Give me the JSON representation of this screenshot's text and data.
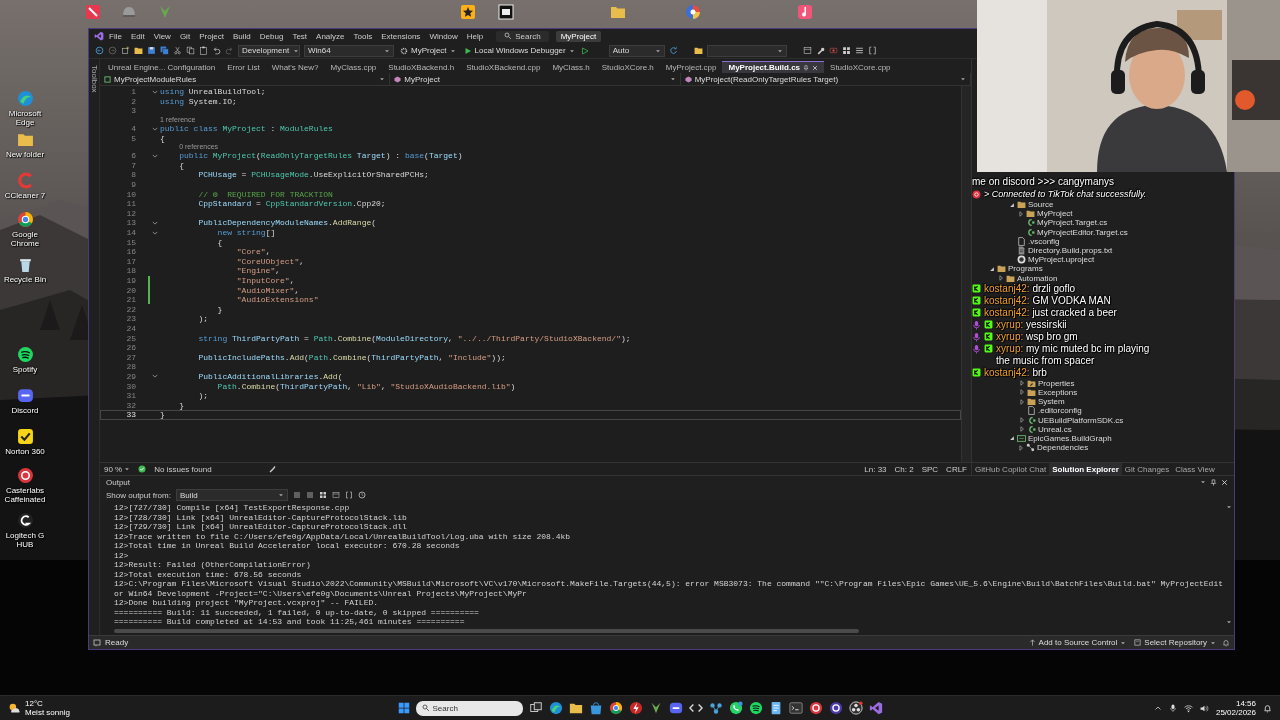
{
  "desktop": {
    "icons": [
      {
        "label": "Microsoft Edge"
      },
      {
        "label": "New folder"
      },
      {
        "label": "CCleaner 7"
      },
      {
        "label": "Google Chrome"
      },
      {
        "label": "Recycle Bin"
      },
      {
        "label": "Spotify"
      },
      {
        "label": "Discord"
      },
      {
        "label": "Norton 360"
      },
      {
        "label": "Casterlabs Caffeinated"
      },
      {
        "label": "Logitech G HUB"
      }
    ]
  },
  "ide": {
    "menu": [
      "File",
      "Edit",
      "View",
      "Git",
      "Project",
      "Build",
      "Debug",
      "Test",
      "Analyze",
      "Tools",
      "Extensions",
      "Window",
      "Help"
    ],
    "search": "Search",
    "project_name": "MyProject",
    "toolbar": {
      "configuration": "Development",
      "platform": "Win64",
      "startup_project": "MyProject",
      "debugger": "Local Windows Debugger",
      "mode": "Auto"
    },
    "toolbox_tab": "Toolbox",
    "tabs": [
      {
        "label": "Unreal Engine... Configuration",
        "selected": false
      },
      {
        "label": "Error List",
        "selected": false
      },
      {
        "label": "What's New?",
        "selected": false
      },
      {
        "label": "MyClass.cpp",
        "selected": false
      },
      {
        "label": "StudioXBackend.h",
        "selected": false
      },
      {
        "label": "StudioXBackend.cpp",
        "selected": false
      },
      {
        "label": "MyClass.h",
        "selected": false
      },
      {
        "label": "StudioXCore.h",
        "selected": false
      },
      {
        "label": "MyProject.cpp",
        "selected": false
      },
      {
        "label": "MyProject.Build.cs",
        "selected": true
      },
      {
        "label": "StudioXCore.cpp",
        "selected": false
      }
    ],
    "navigation": [
      "MyProjectModuleRules",
      "MyProject",
      "MyProject(ReadOnlyTargetRules Target)"
    ],
    "code_lines": [
      {
        "number": "1",
        "fold": true,
        "changed": false,
        "current": false,
        "tokens": [
          {
            "kind": "kw",
            "text": "using"
          },
          {
            "kind": "txt",
            "text": " UnrealBuildTool;"
          }
        ]
      },
      {
        "number": "2",
        "fold": false,
        "changed": false,
        "current": false,
        "tokens": [
          {
            "kind": "kw",
            "text": "using"
          },
          {
            "kind": "txt",
            "text": " System.IO;"
          }
        ]
      },
      {
        "number": "3",
        "fold": false,
        "changed": false,
        "current": false
      },
      {
        "number": "4",
        "fold": true,
        "changed": false,
        "current": false,
        "lens": "1 reference",
        "tokens": [
          {
            "kind": "kw",
            "text": "public class"
          },
          {
            "kind": "type",
            "text": " MyProject"
          },
          {
            "kind": "txt",
            "text": " : "
          },
          {
            "kind": "type",
            "text": "ModuleRules"
          }
        ]
      },
      {
        "number": "5",
        "fold": false,
        "changed": false,
        "current": false,
        "tokens": [
          {
            "kind": "txt",
            "text": "{"
          }
        ]
      },
      {
        "number": "6",
        "fold": true,
        "changed": false,
        "current": false,
        "lens": "0 references",
        "tokens": [
          {
            "kind": "kw",
            "text": "    public"
          },
          {
            "kind": "type",
            "text": " MyProject"
          },
          {
            "kind": "txt",
            "text": "("
          },
          {
            "kind": "type",
            "text": "ReadOnlyTargetRules"
          },
          {
            "kind": "var",
            "text": " Target"
          },
          {
            "kind": "txt",
            "text": ") : "
          },
          {
            "kind": "kw",
            "text": "base"
          },
          {
            "kind": "txt",
            "text": "("
          },
          {
            "kind": "var",
            "text": "Target"
          },
          {
            "kind": "txt",
            "text": ")"
          }
        ]
      },
      {
        "number": "7",
        "fold": false,
        "changed": false,
        "current": false,
        "tokens": [
          {
            "kind": "txt",
            "text": "    {"
          }
        ]
      },
      {
        "number": "8",
        "fold": false,
        "changed": false,
        "current": false,
        "tokens": [
          {
            "kind": "var",
            "text": "        PCHUsage"
          },
          {
            "kind": "txt",
            "text": " = "
          },
          {
            "kind": "type",
            "text": "PCHUsageMode"
          },
          {
            "kind": "txt",
            "text": ".UseExplicitOrSharedPCHs;"
          }
        ]
      },
      {
        "number": "9",
        "fold": false,
        "changed": false,
        "current": false
      },
      {
        "number": "10",
        "fold": false,
        "changed": false,
        "current": false,
        "tokens": [
          {
            "kind": "com",
            "text": "        // ⚙  REQUIRED FOR TRACKTION"
          }
        ]
      },
      {
        "number": "11",
        "fold": false,
        "changed": false,
        "current": false,
        "tokens": [
          {
            "kind": "var",
            "text": "        CppStandard"
          },
          {
            "kind": "txt",
            "text": " = "
          },
          {
            "kind": "type",
            "text": "CppStandardVersion"
          },
          {
            "kind": "txt",
            "text": ".Cpp20;"
          }
        ]
      },
      {
        "number": "12",
        "fold": false,
        "changed": false,
        "current": false
      },
      {
        "number": "13",
        "fold": true,
        "changed": false,
        "current": false,
        "tokens": [
          {
            "kind": "var",
            "text": "        PublicDependencyModuleNames"
          },
          {
            "kind": "txt",
            "text": "."
          },
          {
            "kind": "fn",
            "text": "AddRange"
          },
          {
            "kind": "txt",
            "text": "("
          }
        ]
      },
      {
        "number": "14",
        "fold": true,
        "changed": false,
        "current": false,
        "tokens": [
          {
            "kind": "kw",
            "text": "            new string"
          },
          {
            "kind": "txt",
            "text": "[]"
          }
        ]
      },
      {
        "number": "15",
        "fold": false,
        "changed": false,
        "current": false,
        "tokens": [
          {
            "kind": "txt",
            "text": "            {"
          }
        ]
      },
      {
        "number": "16",
        "fold": false,
        "changed": false,
        "current": false,
        "tokens": [
          {
            "kind": "str",
            "text": "                \"Core\""
          },
          {
            "kind": "txt",
            "text": ","
          }
        ]
      },
      {
        "number": "17",
        "fold": false,
        "changed": false,
        "current": false,
        "tokens": [
          {
            "kind": "str",
            "text": "                \"CoreUObject\""
          },
          {
            "kind": "txt",
            "text": ","
          }
        ]
      },
      {
        "number": "18",
        "fold": false,
        "changed": false,
        "current": false,
        "tokens": [
          {
            "kind": "str",
            "text": "                \"Engine\""
          },
          {
            "kind": "txt",
            "text": ","
          }
        ]
      },
      {
        "number": "19",
        "fold": false,
        "changed": true,
        "current": false,
        "tokens": [
          {
            "kind": "str",
            "text": "                \"InputCore\""
          },
          {
            "kind": "txt",
            "text": ","
          }
        ]
      },
      {
        "number": "20",
        "fold": false,
        "changed": true,
        "current": false,
        "tokens": [
          {
            "kind": "str",
            "text": "                \"AudioMixer\""
          },
          {
            "kind": "txt",
            "text": ","
          }
        ]
      },
      {
        "number": "21",
        "fold": false,
        "changed": true,
        "current": false,
        "tokens": [
          {
            "kind": "str",
            "text": "                \"AudioExtensions\""
          }
        ]
      },
      {
        "number": "22",
        "fold": false,
        "changed": false,
        "current": false,
        "tokens": [
          {
            "kind": "txt",
            "text": "            }"
          }
        ]
      },
      {
        "number": "23",
        "fold": false,
        "changed": false,
        "current": false,
        "tokens": [
          {
            "kind": "txt",
            "text": "        );"
          }
        ]
      },
      {
        "number": "24",
        "fold": false,
        "changed": false,
        "current": false
      },
      {
        "number": "25",
        "fold": false,
        "changed": false,
        "current": false,
        "tokens": [
          {
            "kind": "kw",
            "text": "        string"
          },
          {
            "kind": "var",
            "text": " ThirdPartyPath"
          },
          {
            "kind": "txt",
            "text": " = "
          },
          {
            "kind": "type",
            "text": "Path"
          },
          {
            "kind": "txt",
            "text": "."
          },
          {
            "kind": "fn",
            "text": "Combine"
          },
          {
            "kind": "txt",
            "text": "("
          },
          {
            "kind": "var",
            "text": "ModuleDirectory"
          },
          {
            "kind": "txt",
            "text": ", "
          },
          {
            "kind": "str",
            "text": "\"../../ThirdParty/StudioXBackend/\""
          },
          {
            "kind": "txt",
            "text": ");"
          }
        ]
      },
      {
        "number": "26",
        "fold": false,
        "changed": false,
        "current": false
      },
      {
        "number": "27",
        "fold": false,
        "changed": false,
        "current": false,
        "tokens": [
          {
            "kind": "var",
            "text": "        PublicIncludePaths"
          },
          {
            "kind": "txt",
            "text": "."
          },
          {
            "kind": "fn",
            "text": "Add"
          },
          {
            "kind": "txt",
            "text": "("
          },
          {
            "kind": "type",
            "text": "Path"
          },
          {
            "kind": "txt",
            "text": "."
          },
          {
            "kind": "fn",
            "text": "Combine"
          },
          {
            "kind": "txt",
            "text": "("
          },
          {
            "kind": "var",
            "text": "ThirdPartyPath"
          },
          {
            "kind": "txt",
            "text": ", "
          },
          {
            "kind": "str",
            "text": "\"Include\""
          },
          {
            "kind": "txt",
            "text": "));"
          }
        ]
      },
      {
        "number": "28",
        "fold": false,
        "changed": false,
        "current": false
      },
      {
        "number": "29",
        "fold": true,
        "changed": false,
        "current": false,
        "tokens": [
          {
            "kind": "var",
            "text": "        PublicAdditionalLibraries"
          },
          {
            "kind": "txt",
            "text": "."
          },
          {
            "kind": "fn",
            "text": "Add"
          },
          {
            "kind": "txt",
            "text": "("
          }
        ]
      },
      {
        "number": "30",
        "fold": false,
        "changed": false,
        "current": false,
        "tokens": [
          {
            "kind": "type",
            "text": "            Path"
          },
          {
            "kind": "txt",
            "text": "."
          },
          {
            "kind": "fn",
            "text": "Combine"
          },
          {
            "kind": "txt",
            "text": "("
          },
          {
            "kind": "var",
            "text": "ThirdPartyPath"
          },
          {
            "kind": "txt",
            "text": ", "
          },
          {
            "kind": "str",
            "text": "\"Lib\""
          },
          {
            "kind": "txt",
            "text": ", "
          },
          {
            "kind": "str",
            "text": "\"StudioXAudioBackend.lib\""
          },
          {
            "kind": "txt",
            "text": ")"
          }
        ]
      },
      {
        "number": "31",
        "fold": false,
        "changed": false,
        "current": false,
        "tokens": [
          {
            "kind": "txt",
            "text": "        );"
          }
        ]
      },
      {
        "number": "32",
        "fold": false,
        "changed": false,
        "current": false,
        "tokens": [
          {
            "kind": "txt",
            "text": "    }"
          }
        ]
      },
      {
        "number": "33",
        "fold": false,
        "changed": false,
        "current": true,
        "tokens": [
          {
            "kind": "txt",
            "text": "}"
          }
        ]
      }
    ],
    "editor_status": {
      "zoom": "90 %",
      "issues": "No issues found",
      "line": "Ln: 33",
      "column": "Ch: 2",
      "whitespace": "SPC",
      "line_endings": "CRLF"
    },
    "tree_groups": [
      [
        {
          "label": "Source",
          "kind": "folder",
          "expanded": true,
          "children": [
            {
              "label": "MyProject",
              "kind": "folder",
              "expanded": false
            },
            {
              "label": "MyProject.Target.cs",
              "kind": "code-file"
            },
            {
              "label": "MyProjectEditor.Target.cs",
              "kind": "code-file"
            }
          ]
        },
        {
          "label": ".vsconfig",
          "kind": "file"
        },
        {
          "label": "Directory.Build.props.txt",
          "kind": "document"
        },
        {
          "label": "MyProject.uproject",
          "kind": "project-file"
        }
      ],
      [
        {
          "label": "Programs",
          "kind": "folder",
          "expanded": true,
          "children": [
            {
              "label": "Automation",
              "kind": "folder",
              "expanded": false
            }
          ]
        }
      ],
      [
        {
          "label": "Properties",
          "kind": "properties",
          "expanded": false
        },
        {
          "label": "Exceptions",
          "kind": "folder",
          "expanded": false
        },
        {
          "label": "System",
          "kind": "folder",
          "expanded": false
        },
        {
          "label": ".editorconfig",
          "kind": "file"
        },
        {
          "label": "UEBuildPlatformSDK.cs",
          "kind": "code-node",
          "expanded": false
        },
        {
          "label": "Unreal.cs",
          "kind": "code-node",
          "expanded": false
        }
      ],
      [
        {
          "label": "EpicGames.BuildGraph",
          "kind": "project",
          "expanded": true,
          "children": [
            {
              "label": "Dependencies",
              "kind": "dependencies",
              "expanded": false
            }
          ]
        }
      ]
    ],
    "side_tabs": [
      {
        "label": "GitHub Copilot Chat",
        "selected": false
      },
      {
        "label": "Solution Explorer",
        "selected": true
      },
      {
        "label": "Git Changes",
        "selected": false
      },
      {
        "label": "Class View",
        "selected": false
      }
    ],
    "output": {
      "title": "Output",
      "source_label": "Show output from:",
      "source": "Build",
      "lines": [
        "12>[727/730] Compile [x64] TestExportResponse.cpp",
        "12>[728/730] Link [x64] UnrealEditor-CaptureProtocolStack.lib",
        "12>[729/730] Link [x64] UnrealEditor-CaptureProtocolStack.dll",
        "12>Trace written to file C:/Users/efe0g/AppData/Local/UnrealBuildTool/Log.uba with size 208.4kb",
        "12>Total time in Unreal Build Accelerator local executor: 670.28 seconds",
        "12>",
        "12>Result: Failed (OtherCompilationError)",
        "12>Total execution time: 678.56 seconds",
        "12>C:\\Program Files\\Microsoft Visual Studio\\2022\\Community\\MSBuild\\Microsoft\\VC\\v170\\Microsoft.MakeFile.Targets(44,5): error MSB3073: The command \"\"C:\\Program Files\\Epic Games\\UE_5.6\\Engine\\Build\\BatchFiles\\Build.bat\" MyProjectEditor Win64 Development -Project=\"C:\\Users\\efe0g\\Documents\\Unreal Projects\\MyProject\\MyPr",
        "12>Done building project \"MyProject.vcxproj\" -- FAILED.",
        "========== Build: 11 succeeded, 1 failed, 0 up-to-date, 0 skipped ==========",
        "========== Build completed at 14:53 and took 11:25,461 minutes =========="
      ]
    },
    "status": {
      "text": "Ready",
      "source_control": "Add to Source Control",
      "repository": "Select Repository"
    }
  },
  "chat": {
    "top": [
      {
        "kind": "plain",
        "text": "me on discord >>> cangymanys"
      },
      {
        "kind": "system",
        "text": "> Connected to TikTok chat successfully."
      }
    ],
    "messages": [
      {
        "user": "kostanj42:",
        "text": "drzli goflo",
        "mic_badge": false
      },
      {
        "user": "kostanj42:",
        "text": "GM VODKA MAN",
        "mic_badge": false
      },
      {
        "user": "kostanj42:",
        "text": "just cracked a beer",
        "mic_badge": false
      },
      {
        "user": "xyrup:",
        "text": "yessirskii",
        "mic_badge": true
      },
      {
        "user": "xyrup:",
        "text": "wsp bro gm",
        "mic_badge": true
      },
      {
        "user": "xyrup:",
        "text": "my mic muted bc im playing the music from spacer",
        "mic_badge": true
      },
      {
        "user": "kostanj42:",
        "text": "brb",
        "mic_badge": false
      }
    ]
  },
  "taskbar": {
    "weather": {
      "temperature": "12°C",
      "condition": "Meist sonnig"
    },
    "search": {
      "placeholder": "Search"
    },
    "time": "14:56",
    "date": "25/02/2026"
  }
}
